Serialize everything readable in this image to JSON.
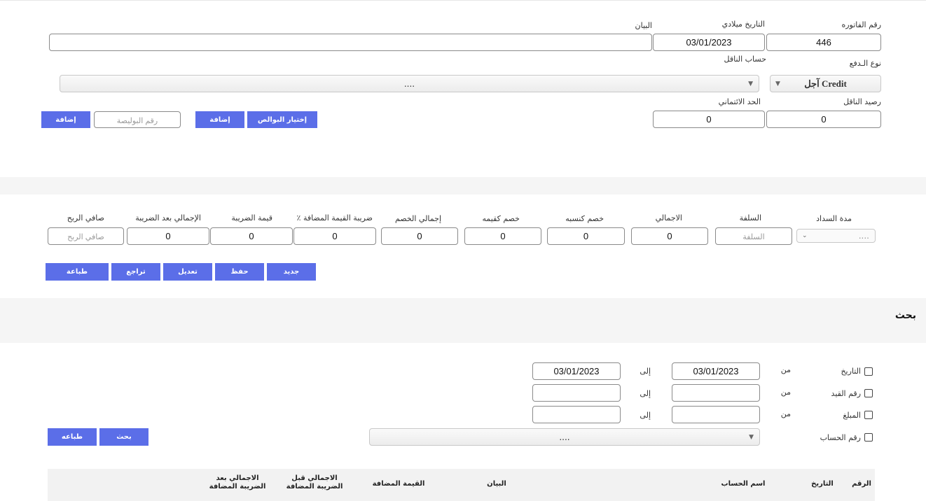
{
  "invoice": {
    "number_label": "رقم الفاتوره",
    "number_value": "446",
    "date_label": "التاريخ ميلادي",
    "date_value": "03/01/2023",
    "statement_label": "البيان",
    "statement_value": "",
    "payment_type_label": "نوع الـدفع",
    "payment_type_value": "آجل Credit",
    "carrier_account_label": "حساب الناقل",
    "carrier_account_value": "....",
    "carrier_balance_label": "رصيد الناقل",
    "carrier_balance_value": "0",
    "credit_limit_label": "الحد الائتماني",
    "credit_limit_value": "0",
    "choose_policies_button": "إختيار البوالص",
    "add_button_1": "إضافة",
    "policy_number_placeholder": "رقم البوليصة",
    "add_button_2": "إضافة"
  },
  "totals": {
    "payment_period_label": "مدة السداد",
    "payment_period_value": "....",
    "advance_label": "السلفة",
    "advance_placeholder": "السلفة",
    "total_label": "الاجمالي",
    "total_value": "0",
    "discount_percent_label": "خصم كنسبه",
    "discount_percent_value": "0",
    "discount_value_label": "خصم كقيمه",
    "discount_value_value": "0",
    "total_discount_label": "إجمالي الخصم",
    "total_discount_value": "0",
    "vat_percent_label": "ضريبة القيمة المضافة ٪",
    "vat_percent_value": "0",
    "tax_value_label": "قيمة الضريبة",
    "tax_value_value": "0",
    "total_after_tax_label": "الإجمالي بعد الضريبة",
    "total_after_tax_value": "0",
    "net_profit_label": "صافي الربح",
    "net_profit_placeholder": "صافي الربح"
  },
  "actions": {
    "new": "جديد",
    "save": "حفظ",
    "edit": "تعديل",
    "undo": "تراجع",
    "print": "طباعة"
  },
  "search": {
    "title": "بحث",
    "from_label": "من",
    "to_label": "إلى",
    "date_label": "التاريخ",
    "date_from": "03/01/2023",
    "date_to": "03/01/2023",
    "entry_label": "رقم القيد",
    "amount_label": "المبلغ",
    "account_label": "رقم الحساب",
    "account_value": "....",
    "search_button": "بحث",
    "print_button": "طباعه"
  },
  "table": {
    "headers": [
      "الرقم",
      "التاريخ",
      "اسم الحساب",
      "البيان",
      "القيمة المضافة",
      "الاجمالي قبل الضريبة المضافة",
      "الاجمالي بعد الضريبة المضافة"
    ]
  },
  "colors": {
    "accent": "#5b6ee8",
    "band": "#f5f5f5"
  }
}
